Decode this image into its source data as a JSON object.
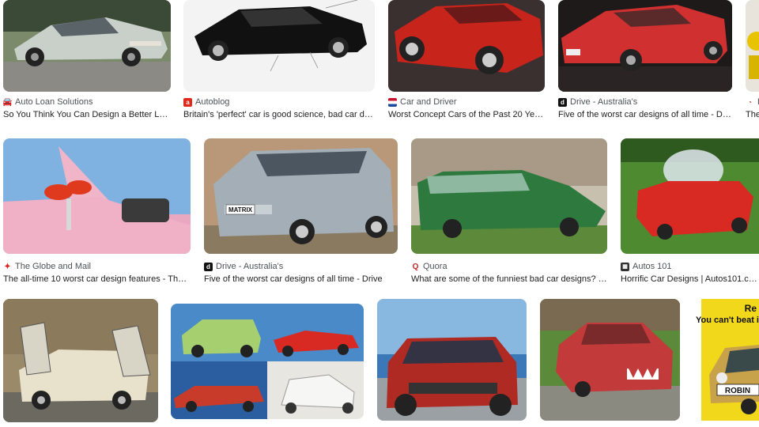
{
  "results": [
    {
      "source": "Auto Loan Solutions",
      "title": "So You Think You Can Design a Better Loo…",
      "favicon": "car-icon",
      "favicon_color": "#555555"
    },
    {
      "source": "Autoblog",
      "title": "Britain's 'perfect' car is good science, bad car de…",
      "favicon": "autoblog-icon",
      "favicon_color": "#e0281c"
    },
    {
      "source": "Car and Driver",
      "title": "Worst Concept Cars of the Past 20 Years",
      "favicon": "flag-icon",
      "favicon_color": "#1a4a9c"
    },
    {
      "source": "Drive - Australia's",
      "title": "Five of the worst car designs of all time - Dri…",
      "favicon": "drive-icon",
      "favicon_color": "#111111"
    },
    {
      "source": "H",
      "title": "The",
      "favicon": "speedometer-icon",
      "favicon_color": "#c0392b"
    },
    {
      "source": "The Globe and Mail",
      "title": "The all-time 10 worst car design features - The …",
      "favicon": "maple-leaf-icon",
      "favicon_color": "#d8231a"
    },
    {
      "source": "Drive - Australia's",
      "title": "Five of the worst car designs of all time - Drive",
      "favicon": "drive-icon",
      "favicon_color": "#111111"
    },
    {
      "source": "Quora",
      "title": "What are some of the funniest bad car designs? - …",
      "favicon": "quora-icon",
      "favicon_color": "#b92b27"
    },
    {
      "source": "Autos 101",
      "title": "Horrific Car Designs | Autos101.c…",
      "favicon": "grid-icon",
      "favicon_color": "#333333"
    },
    {
      "source": "",
      "title": "",
      "favicon": "",
      "favicon_color": ""
    },
    {
      "source": "",
      "title": "",
      "favicon": "",
      "favicon_color": ""
    },
    {
      "source": "",
      "title": "",
      "favicon": "",
      "favicon_color": ""
    },
    {
      "source": "",
      "title": "",
      "favicon": "",
      "favicon_color": ""
    },
    {
      "source": "",
      "title": "",
      "favicon": "",
      "favicon_color": ""
    }
  ],
  "thumb_texts": {
    "matrix_plate": "MATRIX",
    "poster_line1": "Re",
    "poster_line2": "You can't beat i",
    "robin_plate": "ROBIN"
  }
}
